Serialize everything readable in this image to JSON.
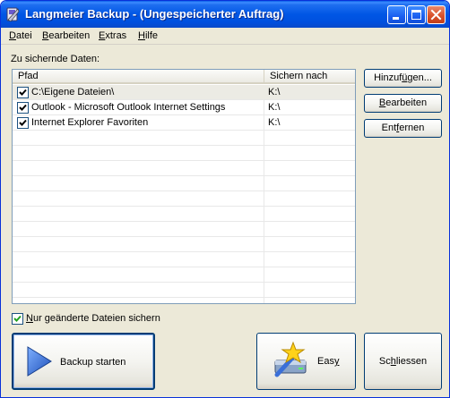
{
  "window": {
    "title": "Langmeier Backup - (Ungespeicherter Auftrag)"
  },
  "menu": [
    {
      "label": "Datei",
      "accel": "D",
      "rest": "atei"
    },
    {
      "label": "Bearbeiten",
      "accel": "B",
      "rest": "earbeiten"
    },
    {
      "label": "Extras",
      "accel": "E",
      "rest": "xtras"
    },
    {
      "label": "Hilfe",
      "accel": "H",
      "rest": "ilfe"
    }
  ],
  "section_label": "Zu sichernde Daten:",
  "table": {
    "columns": [
      "Pfad",
      "Sichern nach"
    ],
    "rows": [
      {
        "checked": true,
        "path": "C:\\Eigene Dateien\\",
        "dest": "K:\\"
      },
      {
        "checked": true,
        "path": "Outlook  - Microsoft Outlook Internet Settings",
        "dest": "K:\\"
      },
      {
        "checked": true,
        "path": "Internet Explorer Favoriten",
        "dest": "K:\\"
      }
    ]
  },
  "side_buttons": {
    "add": {
      "pre": "Hinzuf",
      "accel": "ü",
      "post": "gen..."
    },
    "edit": {
      "pre": "",
      "accel": "B",
      "post": "earbeiten"
    },
    "remove": {
      "pre": "Ent",
      "accel": "f",
      "post": "ernen"
    }
  },
  "option_changed_only": {
    "checked": true,
    "accel": "N",
    "rest": "ur geänderte Dateien sichern"
  },
  "bottom_buttons": {
    "backup": "Backup starten",
    "easy": {
      "pre": "Eas",
      "accel": "y",
      "post": ""
    },
    "close": {
      "pre": "Sc",
      "accel": "h",
      "post": "liessen"
    }
  },
  "colors": {
    "titlebar": "#0054e3",
    "window_bg": "#ece9d8",
    "checkmark": "#21a121",
    "play_arrow": "#2b6fd6"
  }
}
